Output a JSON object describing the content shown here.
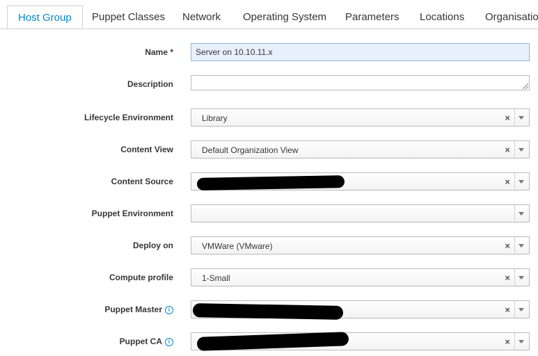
{
  "tabs": [
    {
      "label": "Host Group",
      "active": true
    },
    {
      "label": "Puppet Classes",
      "active": false
    },
    {
      "label": "Network",
      "active": false
    },
    {
      "label": "Operating System",
      "active": false
    },
    {
      "label": "Parameters",
      "active": false
    },
    {
      "label": "Locations",
      "active": false
    },
    {
      "label": "Organisatio",
      "active": false
    }
  ],
  "form": {
    "name": {
      "label": "Name *",
      "value": "Server on 10.10.11.x"
    },
    "description": {
      "label": "Description",
      "value": ""
    },
    "lifecycle_environment": {
      "label": "Lifecycle Environment",
      "value": "Library"
    },
    "content_view": {
      "label": "Content View",
      "value": "Default Organization View"
    },
    "content_source": {
      "label": "Content Source",
      "value": "",
      "redacted": true
    },
    "puppet_environment": {
      "label": "Puppet Environment",
      "value": ""
    },
    "deploy_on": {
      "label": "Deploy on",
      "value": "VMWare (VMware)"
    },
    "compute_profile": {
      "label": "Compute profile",
      "value": "1-Small"
    },
    "puppet_master": {
      "label": "Puppet Master",
      "value": "",
      "redacted": true
    },
    "puppet_ca": {
      "label": "Puppet CA",
      "value": "",
      "redacted": true
    }
  },
  "icons": {
    "info": "info-icon",
    "clear": "clear-icon",
    "caret": "caret-down-icon"
  },
  "colors": {
    "accent": "#0088ce",
    "filled_input": "#e8f0fe"
  }
}
